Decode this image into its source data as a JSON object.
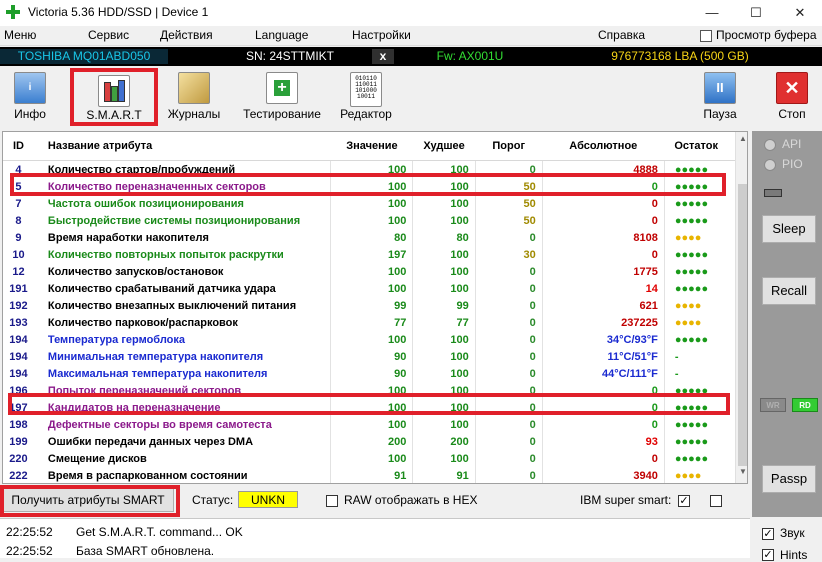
{
  "window": {
    "title": "Victoria 5.36 HDD/SSD | Device 1",
    "controls": {
      "minimize": "—",
      "maximize": "☐",
      "close": "✕"
    }
  },
  "menu": {
    "items": [
      "Меню",
      "Сервис",
      "Действия",
      "Language",
      "Настройки",
      "Справка"
    ],
    "clipboard_label": "Просмотр буфера",
    "clipboard_checked": false
  },
  "device": {
    "model": "TOSHIBA MQ01ABD050",
    "serial": "SN: 24STTMIKT",
    "close_mark": "x",
    "firmware": "Fw: AX001U",
    "capacity": "976773168 LBA (500 GB)"
  },
  "toolbar": {
    "info": "Инфо",
    "info_icon_text": "i",
    "smart": "S.M.A.R.T",
    "journals": "Журналы",
    "testing": "Тестирование",
    "editor": "Редактор",
    "editor_icon_lines": [
      "010110",
      "110011",
      "101000",
      "10011"
    ],
    "pause": "Пауза",
    "pause_icon_text": "II",
    "stop": "Стоп",
    "stop_icon_text": "✕"
  },
  "table": {
    "headers": [
      "ID",
      "Название атрибута",
      "Значение",
      "Худшее",
      "Порог",
      "Абсолютное",
      "Остаток"
    ],
    "rows": [
      {
        "id": "4",
        "name": "Количество стартов/пробуждений",
        "value": "100",
        "worst": "100",
        "threshold": "0",
        "raw": "4888",
        "remain": "●●●●●",
        "name_color": "#000000",
        "raw_color": "#c00000",
        "threshold_color": "#2a8a2a",
        "remain_color": "#1a9a1a"
      },
      {
        "id": "5",
        "name": "Количество переназначенных секторов",
        "value": "100",
        "worst": "100",
        "threshold": "50",
        "raw": "0",
        "remain": "●●●●●",
        "name_color": "#8b1a8b",
        "raw_color": "#1a9a1a",
        "threshold_color": "#a08a00",
        "remain_color": "#1a9a1a"
      },
      {
        "id": "7",
        "name": "Частота ошибок позиционирования",
        "value": "100",
        "worst": "100",
        "threshold": "50",
        "raw": "0",
        "remain": "●●●●●",
        "name_color": "#1a8a1a",
        "raw_color": "#c00000",
        "threshold_color": "#a08a00",
        "remain_color": "#1a9a1a"
      },
      {
        "id": "8",
        "name": "Быстродействие системы позиционирования",
        "value": "100",
        "worst": "100",
        "threshold": "50",
        "raw": "0",
        "remain": "●●●●●",
        "name_color": "#1a8a1a",
        "raw_color": "#c00000",
        "threshold_color": "#a08a00",
        "remain_color": "#1a9a1a"
      },
      {
        "id": "9",
        "name": "Время наработки накопителя",
        "value": "80",
        "worst": "80",
        "threshold": "0",
        "raw": "8108",
        "remain": "●●●●",
        "name_color": "#000000",
        "raw_color": "#c00000",
        "threshold_color": "#2a8a2a",
        "remain_color": "#e8b400"
      },
      {
        "id": "10",
        "name": "Количество повторных попыток раскрутки",
        "value": "197",
        "worst": "100",
        "threshold": "30",
        "raw": "0",
        "remain": "●●●●●",
        "name_color": "#1a8a1a",
        "raw_color": "#c00000",
        "threshold_color": "#a08a00",
        "remain_color": "#1a9a1a"
      },
      {
        "id": "12",
        "name": "Количество запусков/остановок",
        "value": "100",
        "worst": "100",
        "threshold": "0",
        "raw": "1775",
        "remain": "●●●●●",
        "name_color": "#000000",
        "raw_color": "#c00000",
        "threshold_color": "#2a8a2a",
        "remain_color": "#1a9a1a"
      },
      {
        "id": "191",
        "name": "Количество срабатываний датчика удара",
        "value": "100",
        "worst": "100",
        "threshold": "0",
        "raw": "14",
        "remain": "●●●●●",
        "name_color": "#000000",
        "raw_color": "#e00000",
        "threshold_color": "#2a8a2a",
        "remain_color": "#1a9a1a"
      },
      {
        "id": "192",
        "name": "Количество внезапных выключений питания",
        "value": "99",
        "worst": "99",
        "threshold": "0",
        "raw": "621",
        "remain": "●●●●",
        "name_color": "#000000",
        "raw_color": "#c00000",
        "threshold_color": "#2a8a2a",
        "remain_color": "#e8b400"
      },
      {
        "id": "193",
        "name": "Количество парковок/распарковок",
        "value": "77",
        "worst": "77",
        "threshold": "0",
        "raw": "237225",
        "remain": "●●●●",
        "name_color": "#000000",
        "raw_color": "#c00000",
        "threshold_color": "#2a8a2a",
        "remain_color": "#e8b400"
      },
      {
        "id": "194",
        "name": "Температура гермоблока",
        "value": "100",
        "worst": "100",
        "threshold": "0",
        "raw": "34°C/93°F",
        "remain": "●●●●●",
        "name_color": "#1a2ad0",
        "raw_color": "#1a2ad0",
        "threshold_color": "#2a8a2a",
        "remain_color": "#1a9a1a"
      },
      {
        "id": "194",
        "name": "Минимальная температура накопителя",
        "value": "90",
        "worst": "100",
        "threshold": "0",
        "raw": "11°C/51°F",
        "remain": "-",
        "name_color": "#1a2ad0",
        "raw_color": "#1a2ad0",
        "threshold_color": "#2a8a2a",
        "remain_color": "#1a9a1a"
      },
      {
        "id": "194",
        "name": "Максимальная температура накопителя",
        "value": "90",
        "worst": "100",
        "threshold": "0",
        "raw": "44°C/111°F",
        "remain": "-",
        "name_color": "#1a2ad0",
        "raw_color": "#1a2ad0",
        "threshold_color": "#2a8a2a",
        "remain_color": "#1a9a1a"
      },
      {
        "id": "196",
        "name": "Попыток переназначений секторов",
        "value": "100",
        "worst": "100",
        "threshold": "0",
        "raw": "0",
        "remain": "●●●●●",
        "name_color": "#8b1a8b",
        "raw_color": "#1a9a1a",
        "threshold_color": "#2a8a2a",
        "remain_color": "#1a9a1a"
      },
      {
        "id": "197",
        "name": "Кандидатов на переназначение",
        "value": "100",
        "worst": "100",
        "threshold": "0",
        "raw": "0",
        "remain": "●●●●●",
        "name_color": "#8b1a8b",
        "raw_color": "#1a9a1a",
        "threshold_color": "#2a8a2a",
        "remain_color": "#1a9a1a"
      },
      {
        "id": "198",
        "name": "Дефектные секторы во время самотеста",
        "value": "100",
        "worst": "100",
        "threshold": "0",
        "raw": "0",
        "remain": "●●●●●",
        "name_color": "#8b1a8b",
        "raw_color": "#1a9a1a",
        "threshold_color": "#2a8a2a",
        "remain_color": "#1a9a1a"
      },
      {
        "id": "199",
        "name": "Ошибки передачи данных через DMA",
        "value": "200",
        "worst": "200",
        "threshold": "0",
        "raw": "93",
        "remain": "●●●●●",
        "name_color": "#000000",
        "raw_color": "#e00000",
        "threshold_color": "#2a8a2a",
        "remain_color": "#1a9a1a"
      },
      {
        "id": "220",
        "name": "Смещение дисков",
        "value": "100",
        "worst": "100",
        "threshold": "0",
        "raw": "0",
        "remain": "●●●●●",
        "name_color": "#000000",
        "raw_color": "#c00000",
        "threshold_color": "#2a8a2a",
        "remain_color": "#1a9a1a"
      },
      {
        "id": "222",
        "name": "Время в распаркованном состоянии",
        "value": "91",
        "worst": "91",
        "threshold": "0",
        "raw": "3940",
        "remain": "●●●●",
        "name_color": "#000000",
        "raw_color": "#c00000",
        "threshold_color": "#2a8a2a",
        "remain_color": "#e8b400"
      }
    ]
  },
  "status_row": {
    "get_smart_button": "Получить атрибуты SMART",
    "status_label": "Статус:",
    "status_value": "UNKN",
    "raw_hex_label": "RAW отображать в HEX",
    "raw_hex_checked": false,
    "ibm_label": "IBM super smart:",
    "ibm_checked": true,
    "ibm_check_mark": "✓"
  },
  "side_panel": {
    "api_label": "API",
    "pio_label": "PIO",
    "sleep_button": "Sleep",
    "recall_button": "Recall",
    "wr_label": "WR",
    "rd_label": "RD",
    "passp_button": "Passp",
    "sound_label": "Звук",
    "sound_checked": true,
    "hints_label": "Hints",
    "hints_checked": true,
    "check_mark": "✓"
  },
  "log": [
    {
      "time": "22:25:52",
      "message": "Get S.M.A.R.T. command... OK"
    },
    {
      "time": "22:25:52",
      "message": "База SMART обновлена."
    }
  ],
  "colors": {
    "highlight_frame": "#e0202a",
    "status_yellow": "#ffff00",
    "model_cyan": "#19c6e8",
    "fw_green": "#33dd33",
    "lba_yellow": "#f7d516"
  }
}
